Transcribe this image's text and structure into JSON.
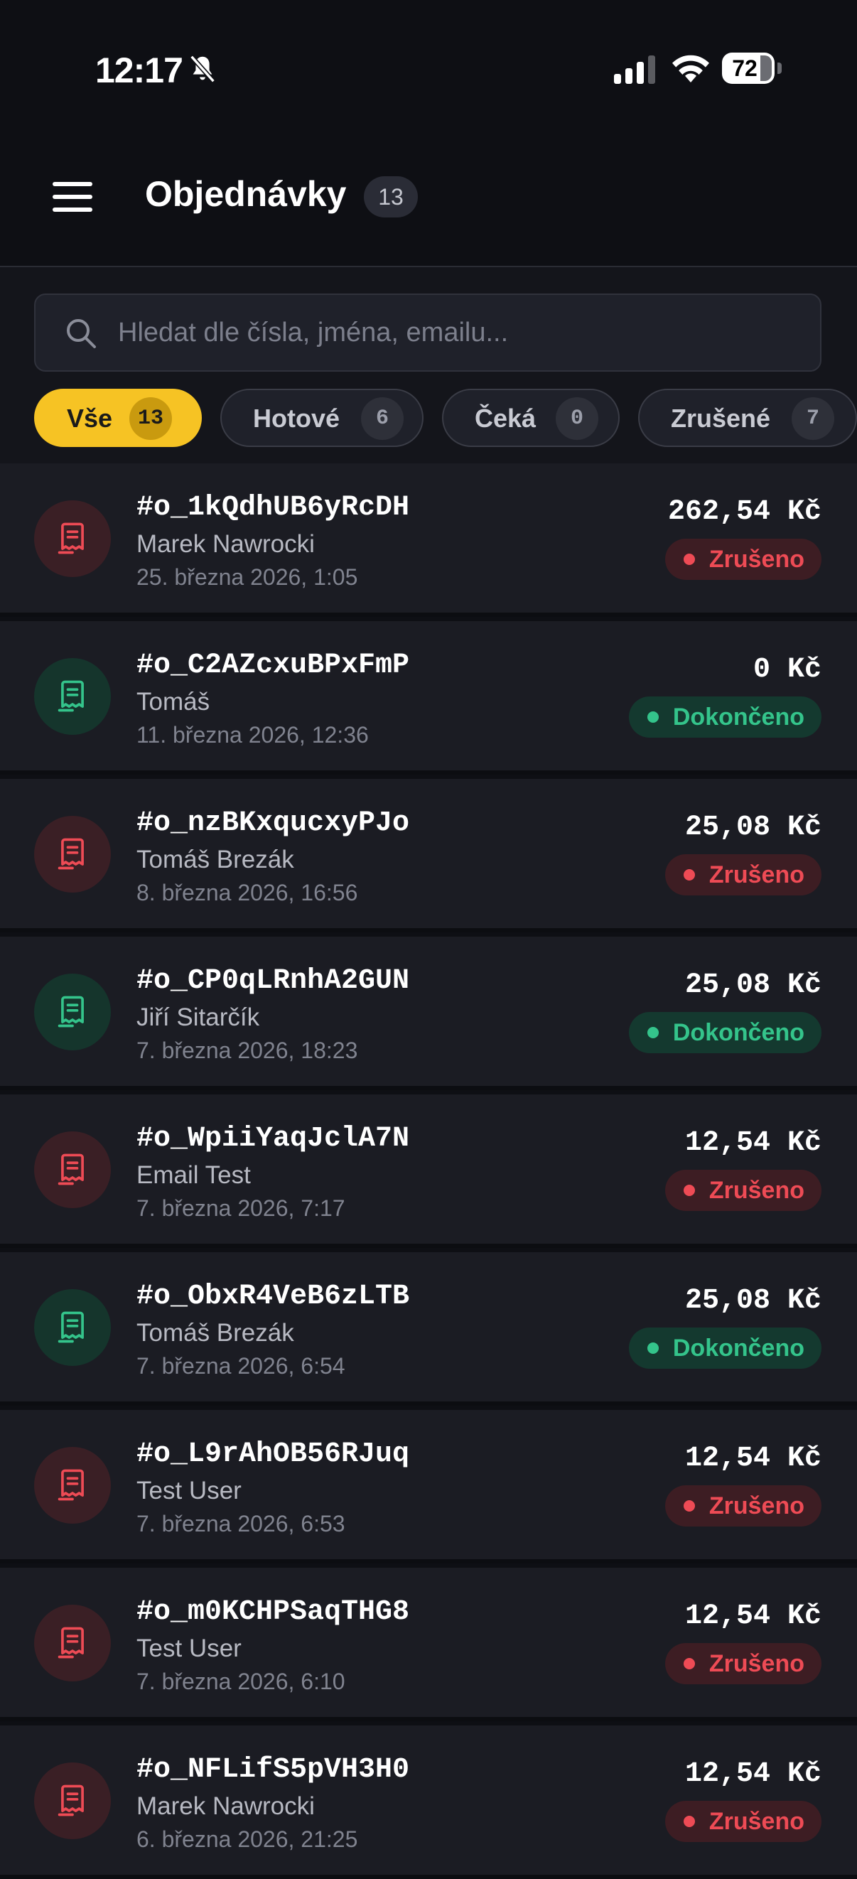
{
  "status_bar": {
    "time": "12:17",
    "battery": "72"
  },
  "header": {
    "title": "Objednávky",
    "count": "13"
  },
  "search": {
    "placeholder": "Hledat dle čísla, jména, emailu..."
  },
  "filters": [
    {
      "label": "Vše",
      "count": "13",
      "active": true
    },
    {
      "label": "Hotové",
      "count": "6",
      "active": false
    },
    {
      "label": "Čeká",
      "count": "0",
      "active": false
    },
    {
      "label": "Zrušené",
      "count": "7",
      "active": false
    }
  ],
  "orders": [
    {
      "id": "#o_1kQdhUB6yRcDH",
      "customer": "Marek Nawrocki",
      "date": "25. března 2026, 1:05",
      "price": "262,54 Kč",
      "status": "Zrušeno",
      "kind": "cancel"
    },
    {
      "id": "#o_C2AZcxuBPxFmP",
      "customer": "Tomáš",
      "date": "11. března 2026, 12:36",
      "price": "0 Kč",
      "status": "Dokončeno",
      "kind": "done"
    },
    {
      "id": "#o_nzBKxqucxyPJo",
      "customer": "Tomáš Brezák",
      "date": "8. března 2026, 16:56",
      "price": "25,08 Kč",
      "status": "Zrušeno",
      "kind": "cancel"
    },
    {
      "id": "#o_CP0qLRnhA2GUN",
      "customer": "Jiří Sitarčík",
      "date": "7. března 2026, 18:23",
      "price": "25,08 Kč",
      "status": "Dokončeno",
      "kind": "done"
    },
    {
      "id": "#o_WpiiYaqJclA7N",
      "customer": "Email Test",
      "date": "7. března 2026, 7:17",
      "price": "12,54 Kč",
      "status": "Zrušeno",
      "kind": "cancel"
    },
    {
      "id": "#o_ObxR4VeB6zLTB",
      "customer": "Tomáš Brezák",
      "date": "7. března 2026, 6:54",
      "price": "25,08 Kč",
      "status": "Dokončeno",
      "kind": "done"
    },
    {
      "id": "#o_L9rAhOB56RJuq",
      "customer": "Test User",
      "date": "7. března 2026, 6:53",
      "price": "12,54 Kč",
      "status": "Zrušeno",
      "kind": "cancel"
    },
    {
      "id": "#o_m0KCHPSaqTHG8",
      "customer": "Test User",
      "date": "7. března 2026, 6:10",
      "price": "12,54 Kč",
      "status": "Zrušeno",
      "kind": "cancel"
    },
    {
      "id": "#o_NFLifS5pVH3H0",
      "customer": "Marek Nawrocki",
      "date": "6. března 2026, 21:25",
      "price": "12,54 Kč",
      "status": "Zrušeno",
      "kind": "cancel"
    }
  ],
  "colors": {
    "accent": "#f6c324",
    "cancel": "#ee4b55",
    "done": "#34c48b",
    "background": "#0e0f14"
  },
  "icons": {
    "menu": "hamburger-icon",
    "search": "magnifier-icon",
    "order": "receipt-icon",
    "bell": "bell-slash-icon"
  }
}
